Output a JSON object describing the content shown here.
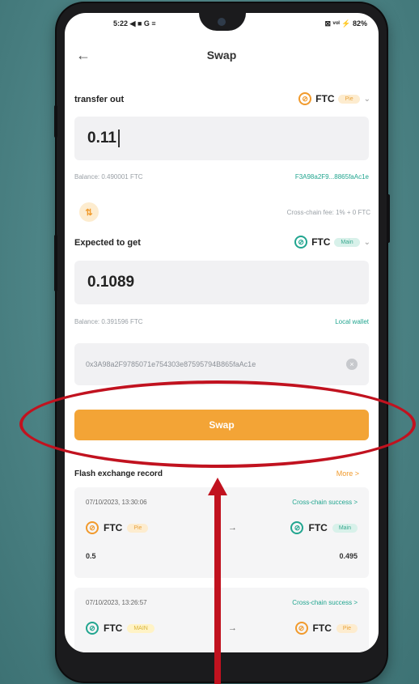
{
  "status_bar": {
    "time": "5:22",
    "icons_left": "◀ ■ G ≡",
    "icons_right": "⊠ ᵛᵒˡ ⚡ 82%"
  },
  "header": {
    "title": "Swap"
  },
  "transfer_out": {
    "label": "transfer out",
    "token": "FTC",
    "tag": "Pie",
    "amount": "0.11",
    "balance": "Balance: 0.490001 FTC",
    "address_short": "F3A98a2F9...8865faAc1e"
  },
  "fee": {
    "text": "Cross-chain fee: 1% + 0 FTC"
  },
  "expected": {
    "label": "Expected to get",
    "token": "FTC",
    "tag": "Main",
    "amount": "0.1089",
    "balance": "Balance: 0.391596 FTC",
    "wallet_link": "Local wallet"
  },
  "receive_address": "0x3A98a2F9785071e754303e87595794B865faAc1e",
  "swap_button": "Swap",
  "records": {
    "header": "Flash exchange record",
    "more": "More >",
    "items": [
      {
        "date": "07/10/2023, 13:30:06",
        "status": "Cross-chain success >",
        "from_token": "FTC",
        "from_tag": "Pie",
        "to_token": "FTC",
        "to_tag": "Main",
        "from_amount": "0.5",
        "to_amount": "0.495"
      },
      {
        "date": "07/10/2023, 13:26:57",
        "status": "Cross-chain success >",
        "from_token": "FTC",
        "from_tag": "MAIN",
        "to_token": "FTC",
        "to_tag": "Pie"
      }
    ]
  },
  "colors": {
    "accent": "#f3a436",
    "green": "#21a58f",
    "annotation_red": "#c1121f"
  }
}
